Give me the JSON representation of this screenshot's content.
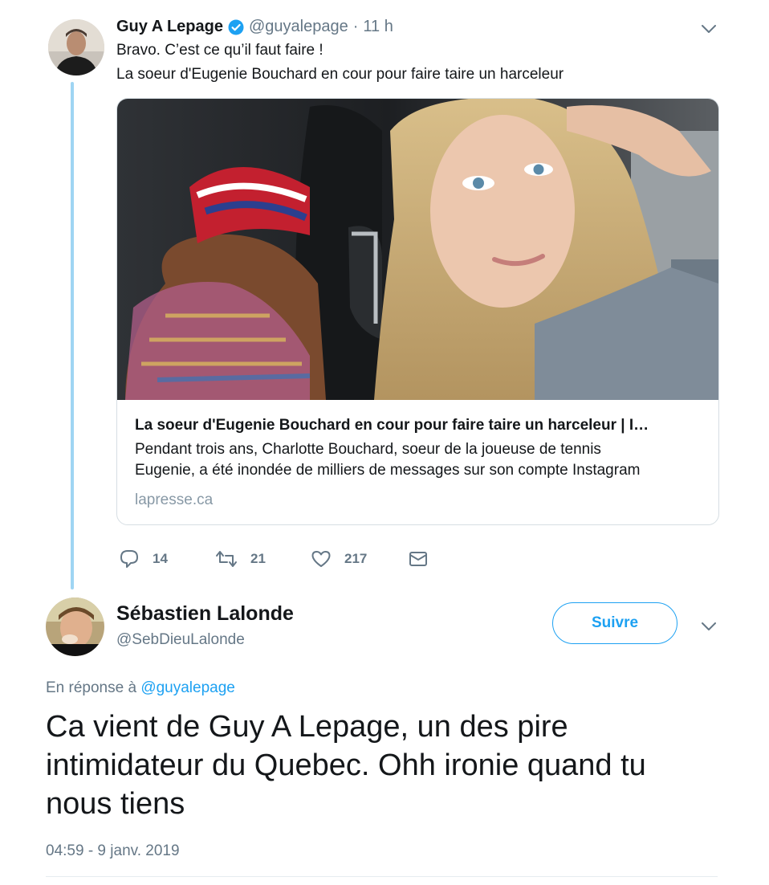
{
  "quoted_tweet": {
    "author_name": "Guy A Lepage",
    "handle": "@guyalepage",
    "separator": "·",
    "time": "11 h",
    "text_line1": "Bravo. C’est ce qu’il faut faire !",
    "text_line2": "La soeur d'Eugenie Bouchard en cour pour faire taire un harceleur",
    "card": {
      "title": "La soeur d'Eugenie Bouchard en cour pour faire taire un harceleur | I…",
      "desc_line1": "Pendant trois ans, Charlotte Bouchard, soeur de la joueuse de tennis",
      "desc_line2": "Eugenie, a été inondée de milliers de messages sur son compte Instagram",
      "domain": "lapresse.ca"
    },
    "actions": {
      "replies": "14",
      "retweets": "21",
      "likes": "217"
    },
    "verified_icon": "verified-badge-icon",
    "menu_icon": "chevron-down-icon"
  },
  "main_tweet": {
    "author_name": "Sébastien Lalonde",
    "handle": "@SebDieuLalonde",
    "follow_label": "Suivre",
    "reply_prefix": "En réponse à",
    "reply_handle": "@guyalepage",
    "text_line1": "Ca vient de Guy A Lepage, un des pire",
    "text_line2": "intimidateur du Quebec. Ohh ironie quand tu",
    "text_line3": "nous tiens",
    "timestamp": "04:59 - 9 janv. 2019"
  },
  "colors": {
    "accent": "#1da1f2",
    "muted": "#657786",
    "thread_line": "#9fd5f3",
    "border": "#d6dee3"
  }
}
